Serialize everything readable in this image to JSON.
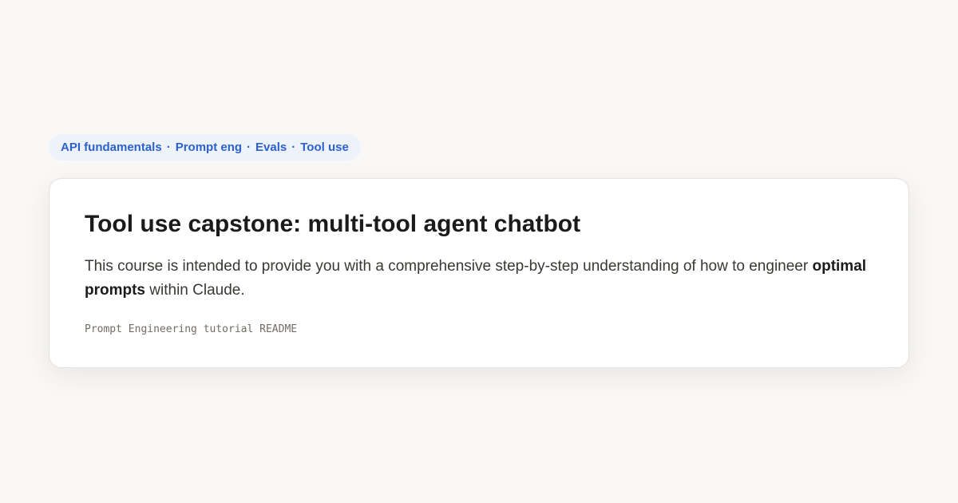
{
  "tags": [
    "API fundamentals",
    "Prompt eng",
    "Evals",
    "Tool use"
  ],
  "tag_separator": "·",
  "card": {
    "title": "Tool use capstone: multi-tool agent chatbot",
    "description_before": "This course is intended to provide you with a comprehensive step-by-step understanding of how to engineer ",
    "description_bold": "optimal prompts",
    "description_after": " within Claude.",
    "source": "Prompt Engineering tutorial README"
  },
  "colors": {
    "background": "#f9f8f6",
    "pill_background": "#edf2fb",
    "accent": "#2c62cf",
    "title": "#1c1b19",
    "body_text": "#3a3834",
    "muted": "#716d66"
  }
}
